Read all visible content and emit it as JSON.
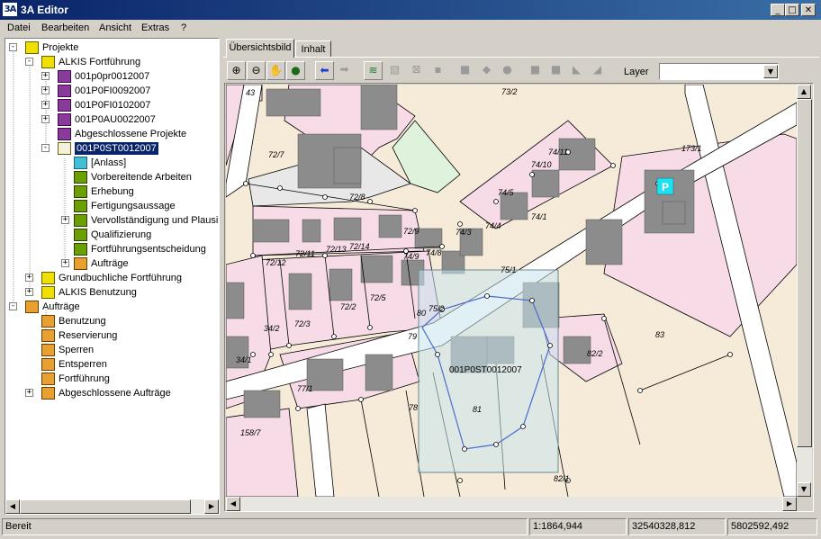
{
  "window": {
    "title": "3A Editor",
    "icon_text": "3A"
  },
  "menu": [
    "Datei",
    "Bearbeiten",
    "Ansicht",
    "Extras",
    "?"
  ],
  "tree": {
    "root_projects": "Projekte",
    "alkis_fortfuehrung": "ALKIS Fortführung",
    "projects": [
      "001p0pr0012007",
      "001P0FI0092007",
      "001P0FI0102007",
      "001P0AU0022007"
    ],
    "closed_projects": "Abgeschlossene Projekte",
    "selected_project": "001P0ST0012007",
    "selected_children": [
      "[Anlass]",
      "Vorbereitende Arbeiten",
      "Erhebung",
      "Fertigungsaussage",
      "Vervollständigung und Plausibilisierung",
      "Qualifizierung",
      "Fortführungsentscheidung",
      "Aufträge"
    ],
    "grundbuch": "Grundbuchliche Fortführung",
    "alkis_benutzung": "ALKIS Benutzung",
    "root_orders": "Aufträge",
    "orders": [
      "Benutzung",
      "Reservierung",
      "Sperren",
      "Entsperren",
      "Fortführung",
      "Abgeschlossene Aufträge"
    ]
  },
  "tabs": [
    "Übersichtsbild",
    "Inhalt"
  ],
  "toolbar": {
    "layer_label": "Layer",
    "layer_value": ""
  },
  "map": {
    "selection_label": "001P0ST0012007",
    "parking_symbol": "P",
    "parcels": {
      "p43": "43",
      "p73_2": "73/2",
      "p72_7": "72/7",
      "p72_8": "72/8",
      "p173_1": "173/1",
      "p74_11": "74/11",
      "p74_10": "74/10",
      "p74_5": "74/5",
      "p74_1": "74/1",
      "p74_4": "74/4",
      "p74_3": "74/3",
      "p72_9": "72/9",
      "p74_9": "74/9",
      "p74_8": "74/8",
      "p75_1": "75/1",
      "p72_11": "72/11",
      "p72_13": "72/13",
      "p72_14": "72/14",
      "p72_12": "72/12",
      "p72_2": "72/2",
      "p72_5": "72/5",
      "p72_3": "72/3",
      "p80": "80",
      "p75_2": "75/2",
      "p34_2": "34/2",
      "p79": "79",
      "p83": "83",
      "p34_1": "34/1",
      "p82_2": "82/2",
      "p77_1": "77/1",
      "p78": "78",
      "p81": "81",
      "p158_7": "158/7",
      "p82_1": "82/1"
    }
  },
  "status": {
    "text": "Bereit",
    "scale": "1:1864,944",
    "x": "32540328,812",
    "y": "5802592,492"
  }
}
